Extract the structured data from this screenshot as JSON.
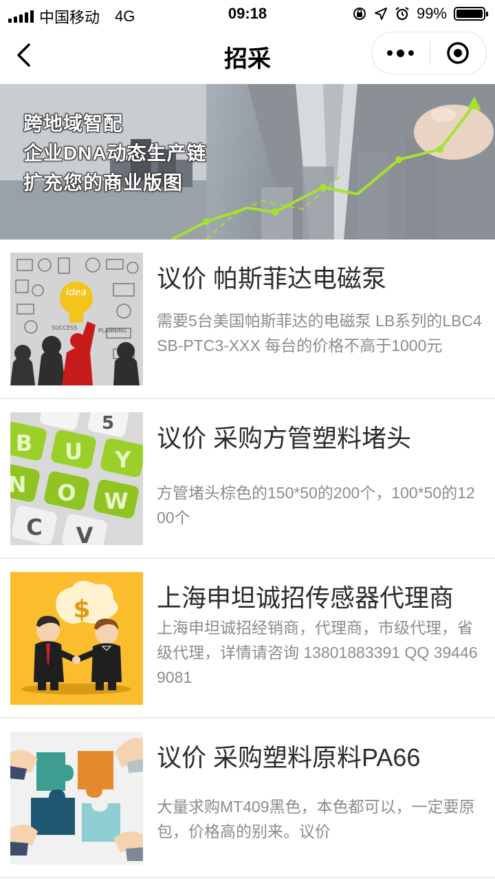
{
  "status_bar": {
    "carrier": "中国移动",
    "network": "4G",
    "time": "09:18",
    "battery": "99%",
    "battery_level": 0.99,
    "icons": [
      "signal-icon",
      "orientation-lock-icon",
      "location-icon",
      "alarm-icon",
      "battery-icon"
    ]
  },
  "nav": {
    "title": "招采",
    "icons": [
      "back-arrow-icon",
      "more-dots-icon",
      "close-target-icon"
    ]
  },
  "banner": {
    "lines": [
      "跨地域智配",
      "企业DNA动态生产链",
      "扩充您的商业版图"
    ],
    "accent_color": "#a6e22e"
  },
  "items": [
    {
      "title": "议价 帕斯菲达电磁泵",
      "description": "需要5台美国帕斯菲达的电磁泵 LB系列的LBC4SB-PTC3-XXX 每台的价格不高于1000元",
      "thumb_text": "idea"
    },
    {
      "title": "议价 采购方管塑料堵头",
      "description": "方管堵头棕色的150*50的200个，100*50的1200个",
      "thumb_keys": [
        "5",
        "B",
        "U",
        "Y",
        "N",
        "O",
        "W",
        "C",
        "V"
      ]
    },
    {
      "title": "上海申坦诚招传感器代理商",
      "description": "上海申坦诚招经销商，代理商，市级代理，省级代理，详情请咨询 13801883391 QQ 394469081",
      "thumb_text": "$"
    },
    {
      "title": "议价 采购塑料原料PA66",
      "description": "大量求购MT409黑色，本色都可以，一定要原包，价格高的别来。议价"
    }
  ]
}
